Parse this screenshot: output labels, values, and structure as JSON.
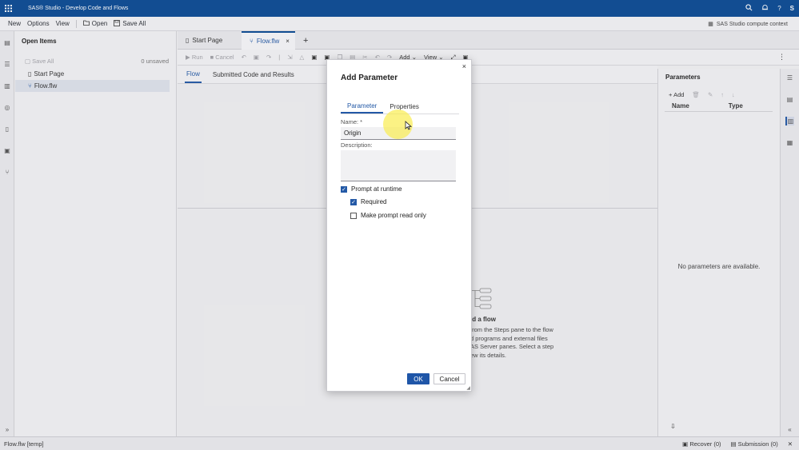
{
  "titlebar": {
    "title": "SAS® Studio - Develop Code and Flows",
    "avatar": "S"
  },
  "menubar": {
    "items": [
      "New",
      "Options",
      "View",
      "Open",
      "Save All"
    ],
    "context": "SAS Studio compute context"
  },
  "open_items": {
    "header": "Open Items",
    "save_all": "Save All",
    "unsaved": "0 unsaved",
    "items": [
      "Start Page",
      "Flow.flw"
    ]
  },
  "tabs": [
    "Start Page",
    "Flow.flw"
  ],
  "toolbar": {
    "run": "Run",
    "cancel": "Cancel",
    "add": "Add",
    "view": "View"
  },
  "subtabs": [
    "Flow",
    "Submitted Code and Results"
  ],
  "canvas": {
    "empty_title": "ld a flow",
    "empty_desc": "from the Steps pane to the flow\nd programs and external files\nAS Server panes. Select a step\new its details."
  },
  "parameters_pane": {
    "title": "Parameters",
    "add": "Add",
    "col_name": "Name",
    "col_type": "Type",
    "empty": "No parameters are available."
  },
  "dialog": {
    "title": "Add Parameter",
    "tabs": [
      "Parameter",
      "Properties"
    ],
    "name_label": "Name: *",
    "name_value": "Origin",
    "description_label": "Description:",
    "prompt_runtime": "Prompt at runtime",
    "prompt_runtime_checked": true,
    "required": "Required",
    "required_checked": true,
    "read_only": "Make prompt read only",
    "read_only_checked": false,
    "ok": "OK",
    "cancel": "Cancel"
  },
  "statusbar": {
    "file": "Flow.flw [temp]",
    "recover": "Recover (0)",
    "submission": "Submission (0)"
  },
  "colors": {
    "brand": "#0a4a94",
    "accent": "#2359a6"
  }
}
